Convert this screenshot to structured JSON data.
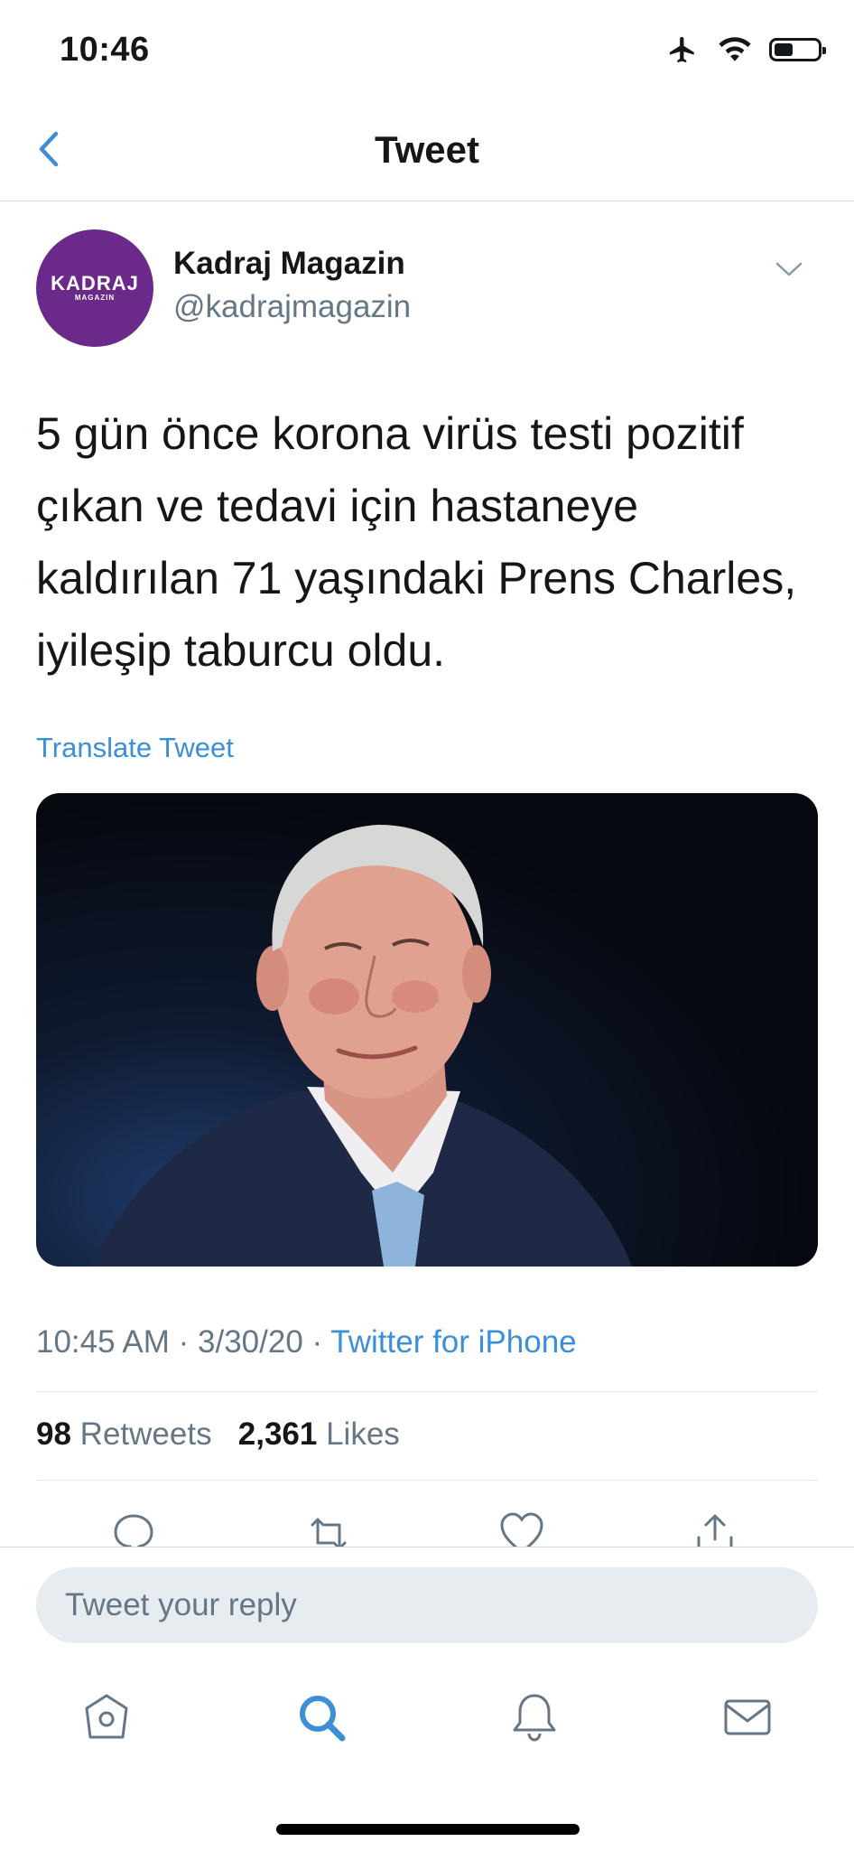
{
  "status_bar": {
    "time": "10:46"
  },
  "header": {
    "title": "Tweet"
  },
  "author": {
    "name": "Kadraj Magazin",
    "handle": "@kadrajmagazin",
    "avatar_text": "KADRAJ",
    "avatar_subtext": "MAGAZIN"
  },
  "tweet": {
    "text": "5 gün önce korona virüs testi pozitif çıkan ve tedavi için hastaneye kaldırılan 71 yaşındaki Prens Charles, iyileşip taburcu oldu.",
    "translate_label": "Translate Tweet",
    "time": "10:45 AM",
    "date": "3/30/20",
    "source": "Twitter for iPhone"
  },
  "stats": {
    "retweets_count": "98",
    "retweets_label": "Retweets",
    "likes_count": "2,361",
    "likes_label": "Likes"
  },
  "reply": {
    "placeholder": "Tweet your reply"
  },
  "colors": {
    "accent": "#3a8fd6",
    "avatar_bg": "#6b2a8a"
  }
}
